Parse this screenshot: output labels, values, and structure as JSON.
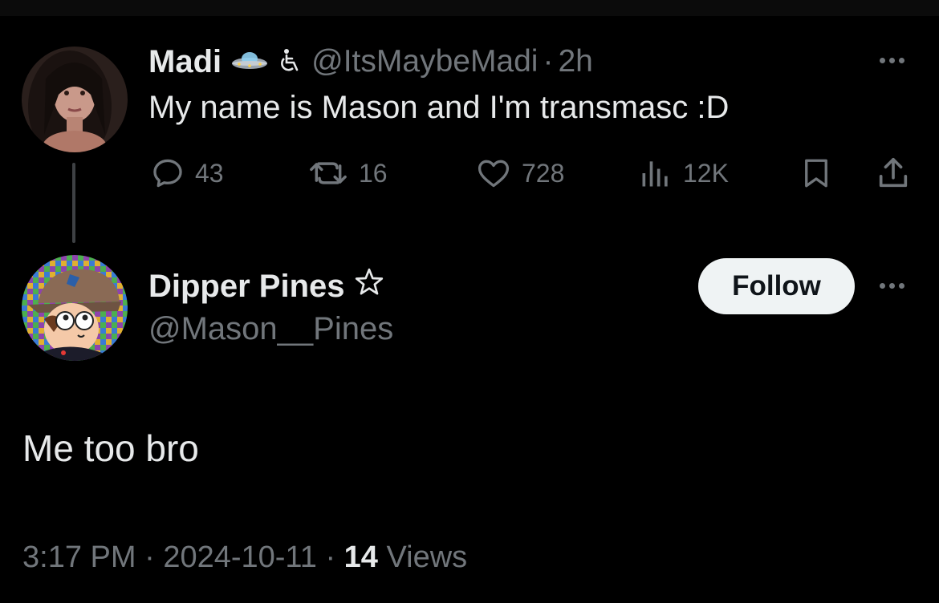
{
  "parent_tweet": {
    "display_name": "Madi",
    "name_emoji": "ufo",
    "handle_emoji": "wheelchair-symbol",
    "handle": "@ItsMaybeMadi",
    "separator": "·",
    "time": "2h",
    "text": "My name is Mason and I'm transmasc :D",
    "actions": {
      "replies": "43",
      "retweets": "16",
      "likes": "728",
      "views": "12K"
    }
  },
  "reply_tweet": {
    "display_name": "Dipper Pines",
    "name_symbol": "star-outline",
    "handle": "@Mason__Pines",
    "follow_label": "Follow",
    "text": "Me too bro",
    "time": "3:17 PM",
    "separator": "·",
    "date": "2024-10-11",
    "views_count": "14",
    "views_label": "Views"
  },
  "colors": {
    "background": "#000000",
    "text_primary": "#e7e9ea",
    "text_secondary": "#71767b",
    "follow_bg": "#eff3f4",
    "follow_text": "#0f1419",
    "thread_line": "#3e4144"
  }
}
